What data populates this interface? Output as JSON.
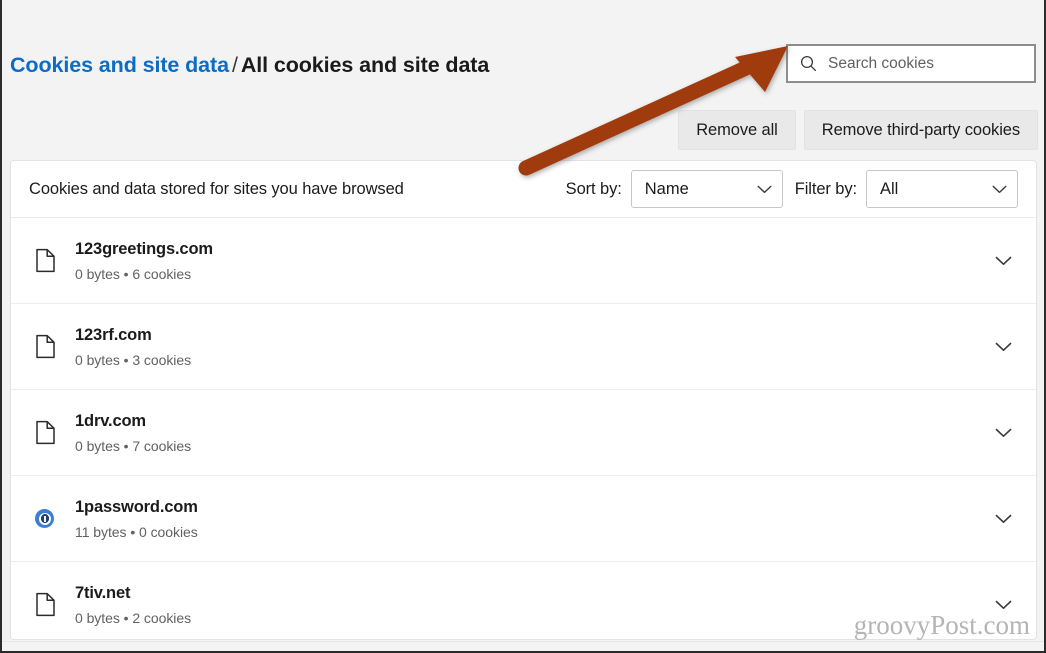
{
  "breadcrumb": {
    "parent": "Cookies and site data",
    "separator": "/",
    "current": "All cookies and site data"
  },
  "search": {
    "placeholder": "Search cookies",
    "value": "",
    "icon": "search-icon"
  },
  "actions": {
    "remove_all": "Remove all",
    "remove_third_party": "Remove third-party cookies"
  },
  "list_header": {
    "title": "Cookies and data stored for sites you have browsed",
    "sort_label": "Sort by:",
    "sort_value": "Name",
    "sort_options": [
      "Name"
    ],
    "filter_label": "Filter by:",
    "filter_value": "All",
    "filter_options": [
      "All"
    ]
  },
  "sites": [
    {
      "name": "123greetings.com",
      "details": "0 bytes • 6 cookies",
      "icon": "document-icon",
      "expand_icon": "chevron-down-icon"
    },
    {
      "name": "123rf.com",
      "details": "0 bytes • 3 cookies",
      "icon": "document-icon",
      "expand_icon": "chevron-down-icon"
    },
    {
      "name": "1drv.com",
      "details": "0 bytes • 7 cookies",
      "icon": "document-icon",
      "expand_icon": "chevron-down-icon"
    },
    {
      "name": "1password.com",
      "details": "11 bytes • 0 cookies",
      "icon": "1password-favicon",
      "expand_icon": "chevron-down-icon"
    },
    {
      "name": "7tiv.net",
      "details": "0 bytes • 2 cookies",
      "icon": "document-icon",
      "expand_icon": "chevron-down-icon"
    }
  ],
  "annotation": {
    "type": "arrow",
    "points_to": "search-box",
    "color": "#a03a10"
  },
  "watermark": {
    "text": "groovyPost.com"
  },
  "colors": {
    "link": "#0d6cc4",
    "page_bg": "#f3f3f3",
    "card_bg": "#ffffff",
    "arrow": "#a03a10",
    "watermark": "#b5b5b5"
  }
}
